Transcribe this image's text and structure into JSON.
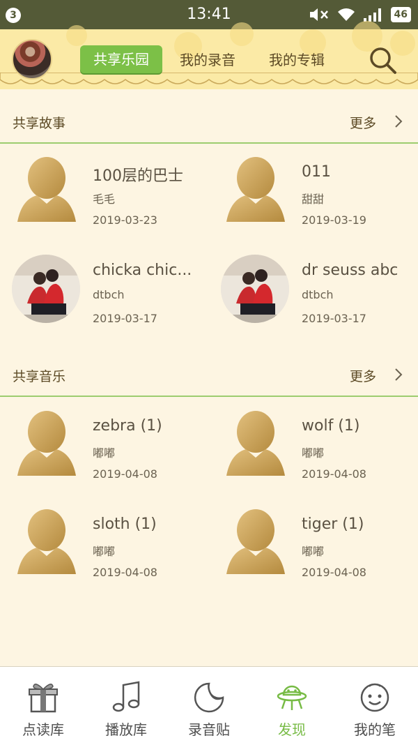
{
  "status_bar": {
    "notification_count": "3",
    "time": "13:41",
    "battery": "46",
    "icons": [
      "mute-icon",
      "wifi-icon",
      "signal-icon",
      "battery-icon"
    ]
  },
  "header": {
    "tabs": [
      {
        "label": "共享乐园",
        "active": true
      },
      {
        "label": "我的录音",
        "active": false
      },
      {
        "label": "我的专辑",
        "active": false
      }
    ],
    "accent": "#7cc047"
  },
  "sections": [
    {
      "title": "共享故事",
      "more_label": "更多",
      "items": [
        {
          "title": "100层的巴士",
          "author": "毛毛",
          "date": "2019-03-23",
          "thumb": "default-avatar"
        },
        {
          "title": "011",
          "author": "甜甜",
          "date": "2019-03-19",
          "thumb": "default-avatar"
        },
        {
          "title": "chicka chic...",
          "author": "dtbch",
          "date": "2019-03-17",
          "thumb": "photo"
        },
        {
          "title": "dr seuss abc",
          "author": "dtbch",
          "date": "2019-03-17",
          "thumb": "photo"
        }
      ]
    },
    {
      "title": "共享音乐",
      "more_label": "更多",
      "items": [
        {
          "title": "zebra (1)",
          "author": "嘟嘟",
          "date": "2019-04-08",
          "thumb": "default-avatar"
        },
        {
          "title": "wolf (1)",
          "author": "嘟嘟",
          "date": "2019-04-08",
          "thumb": "default-avatar"
        },
        {
          "title": "sloth (1)",
          "author": "嘟嘟",
          "date": "2019-04-08",
          "thumb": "default-avatar"
        },
        {
          "title": "tiger (1)",
          "author": "嘟嘟",
          "date": "2019-04-08",
          "thumb": "default-avatar"
        }
      ]
    }
  ],
  "bottom_nav": [
    {
      "label": "点读库",
      "icon": "gift-icon",
      "active": false
    },
    {
      "label": "播放库",
      "icon": "music-note-icon",
      "active": false
    },
    {
      "label": "录音贴",
      "icon": "sticker-icon",
      "active": false
    },
    {
      "label": "发现",
      "icon": "ufo-icon",
      "active": true
    },
    {
      "label": "我的笔",
      "icon": "face-icon",
      "active": false
    }
  ]
}
